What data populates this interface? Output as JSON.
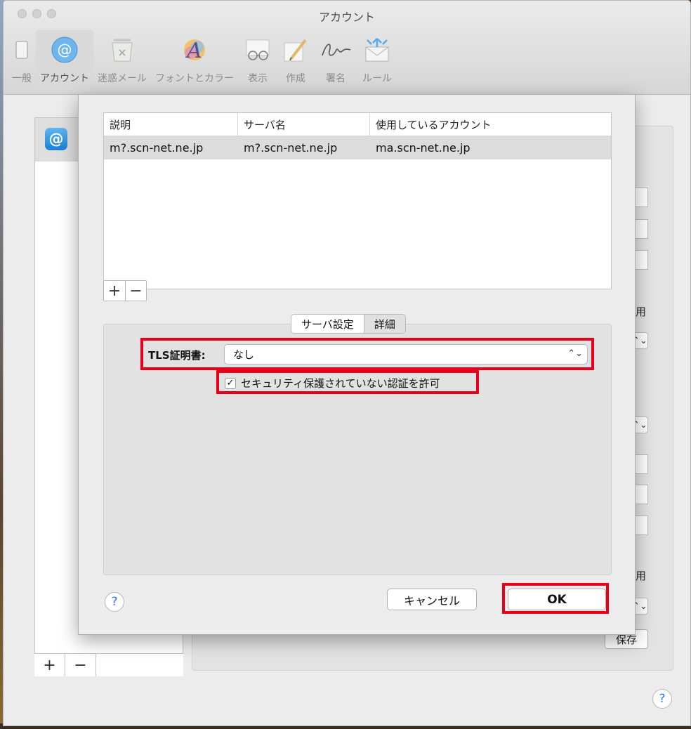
{
  "window": {
    "title": "アカウント"
  },
  "toolbar": {
    "items": [
      {
        "label": "一般",
        "icon": "switch-icon"
      },
      {
        "label": "アカウント",
        "icon": "at-icon",
        "active": true
      },
      {
        "label": "迷惑メール",
        "icon": "junk-bin-icon"
      },
      {
        "label": "フォントとカラー",
        "icon": "font-color-icon"
      },
      {
        "label": "表示",
        "icon": "glasses-icon"
      },
      {
        "label": "作成",
        "icon": "pencil-icon"
      },
      {
        "label": "署名",
        "icon": "signature-icon"
      },
      {
        "label": "ルール",
        "icon": "rules-envelope-icon"
      }
    ]
  },
  "background": {
    "partial_text_1": "用",
    "partial_text_2": "用",
    "save_label": "保存",
    "plus": "+",
    "minus": "−"
  },
  "sheet": {
    "table": {
      "headers": [
        "説明",
        "サーバ名",
        "使用しているアカウント"
      ],
      "rows": [
        [
          "m?.scn-net.ne.jp",
          "m?.scn-net.ne.jp",
          "ma.scn-net.ne.jp"
        ]
      ]
    },
    "add_label": "+",
    "remove_label": "−",
    "tabs": [
      "サーバ設定",
      "詳細"
    ],
    "tls_label": "TLS証明書:",
    "tls_value": "なし",
    "checkbox_label": "セキュリティ保護されていない認証を許可",
    "checkbox_checked": true,
    "cancel_label": "キャンセル",
    "ok_label": "OK",
    "help_label": "?"
  },
  "colors": {
    "highlight": "#e8001b",
    "accent": "#1a7fd6"
  }
}
